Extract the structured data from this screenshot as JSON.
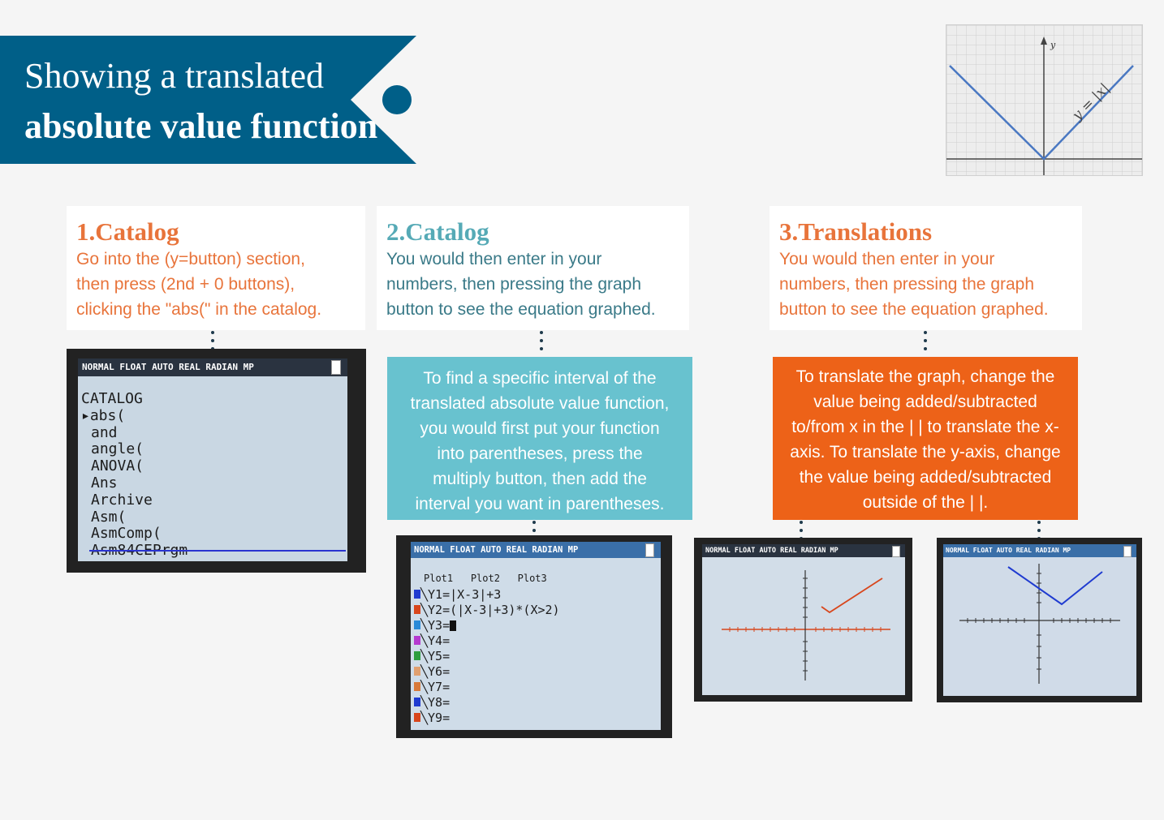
{
  "banner": {
    "title_line1": "Showing a translated",
    "title_line2": "absolute value function",
    "color": "#005f88"
  },
  "thumbnail": {
    "equation_label": "y = |x|",
    "y_axis_label": "y"
  },
  "steps": [
    {
      "title": "1.Catalog",
      "body": [
        "Go into the (y=button) section,",
        "then press (2nd + 0 buttons),",
        "clicking the \"abs(\" in the catalog."
      ],
      "color": "#e8743b"
    },
    {
      "title": "2.Catalog",
      "body": [
        "You would then enter in your",
        "numbers, then pressing the graph",
        "button to see the equation graphed."
      ],
      "color": "#56aab6"
    },
    {
      "title": "3.Translations",
      "body": [
        "You would then enter in your",
        "numbers, then pressing the graph",
        "button to see the equation graphed."
      ],
      "color": "#e8743b"
    }
  ],
  "info_interval": {
    "lines": [
      "To find a specific interval of the",
      "translated absolute value function,",
      "you would first put your function",
      "into parentheses, press the",
      "multiply button, then add the",
      "interval you want in parentheses."
    ],
    "color": "#68c2cf"
  },
  "info_translate": {
    "lines": [
      "To translate the graph, change the",
      "value being added/subtracted",
      "to/from x in the | | to translate the x-",
      "axis. To translate the y-axis, change",
      "the value being added/subtracted",
      "outside of the | |."
    ],
    "color": "#ed6218"
  },
  "calc_status": "NORMAL FLOAT AUTO REAL RADIAN MP",
  "catalog_screen": {
    "header": "CATALOG",
    "items": [
      "abs(",
      "and",
      "angle(",
      "ANOVA(",
      "Ans",
      "Archive",
      "Asm(",
      "AsmComp(",
      "Asm84CEPrgm"
    ]
  },
  "yequals_screen": {
    "plots": [
      "Plot1",
      "Plot2",
      "Plot3"
    ],
    "rows": [
      {
        "label": "Y1",
        "expr": "|X-3|+3",
        "color": "#1f3bd0"
      },
      {
        "label": "Y2",
        "expr": "(|X-3|+3)*(X>2)",
        "color": "#d8461c"
      },
      {
        "label": "Y3",
        "expr": "",
        "color": "#2a8ad8"
      },
      {
        "label": "Y4",
        "expr": "",
        "color": "#b53ad0"
      },
      {
        "label": "Y5",
        "expr": "",
        "color": "#2e9e3e"
      },
      {
        "label": "Y6",
        "expr": "",
        "color": "#e0a070"
      },
      {
        "label": "Y7",
        "expr": "",
        "color": "#d87a3a"
      },
      {
        "label": "Y8",
        "expr": "",
        "color": "#1f3bd0"
      },
      {
        "label": "Y9",
        "expr": "",
        "color": "#d8461c"
      }
    ]
  }
}
